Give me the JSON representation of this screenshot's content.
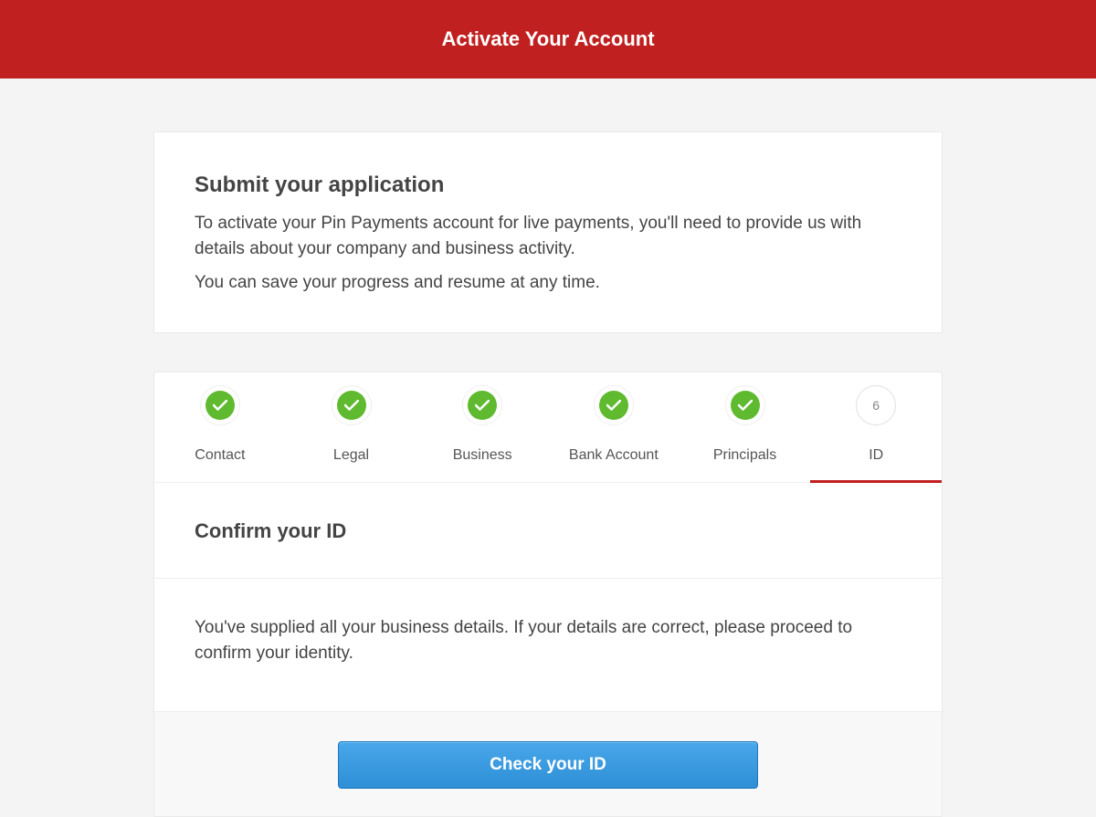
{
  "header": {
    "title": "Activate Your Account"
  },
  "intro": {
    "heading": "Submit your application",
    "p1": "To activate your Pin Payments account for live payments, you'll need to provide us with details about your company and business activity.",
    "p2": "You can save your progress and resume at any time."
  },
  "steps": {
    "contact": {
      "label": "Contact"
    },
    "legal": {
      "label": "Legal"
    },
    "business": {
      "label": "Business"
    },
    "bank": {
      "label": "Bank Account"
    },
    "principals": {
      "label": "Principals"
    },
    "id": {
      "label": "ID",
      "number": "6"
    }
  },
  "panel": {
    "title": "Confirm your ID",
    "body": "You've supplied all your business details. If your details are correct, please proceed to confirm your identity.",
    "cta": "Check your ID"
  }
}
